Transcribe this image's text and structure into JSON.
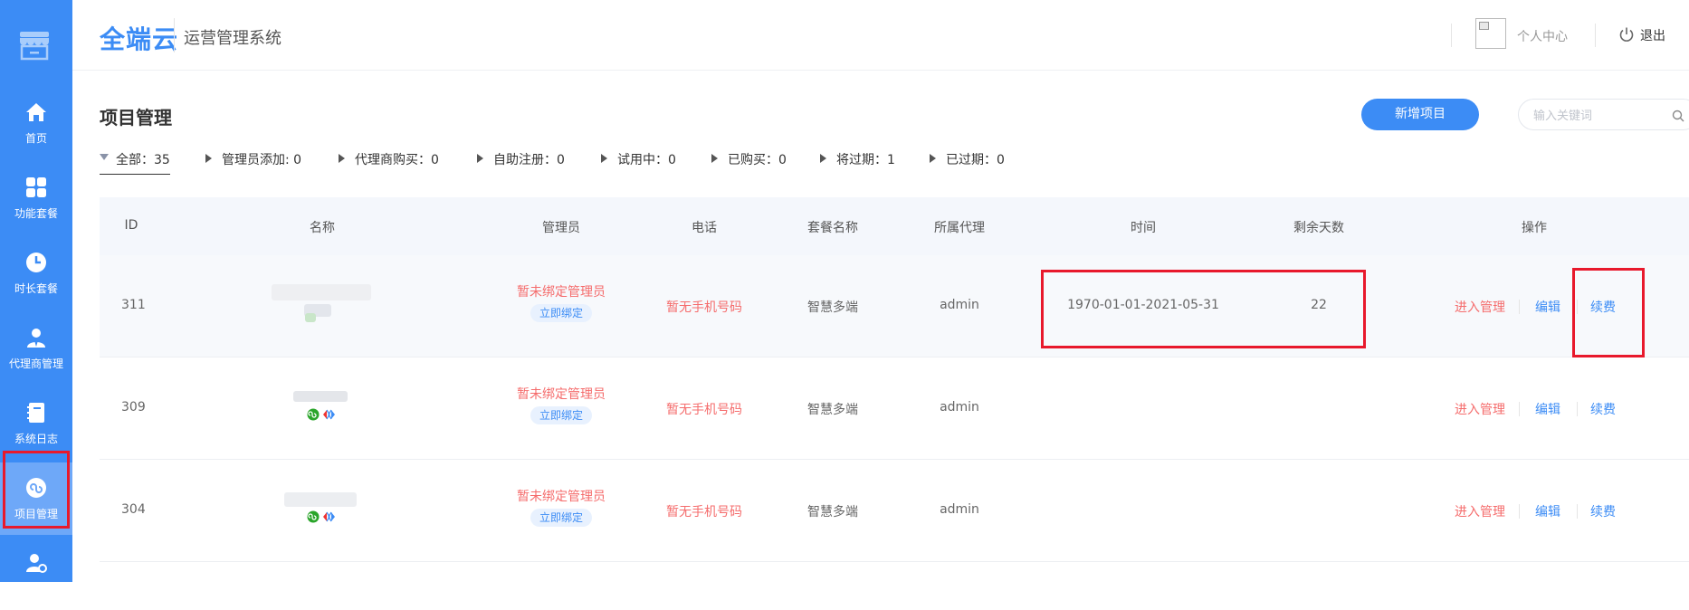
{
  "sidebar": {
    "items": [
      {
        "label": "首页",
        "icon": "home-icon"
      },
      {
        "label": "功能套餐",
        "icon": "grid-icon"
      },
      {
        "label": "时长套餐",
        "icon": "clock-icon"
      },
      {
        "label": "代理商管理",
        "icon": "agent-icon"
      },
      {
        "label": "系统日志",
        "icon": "log-book-icon"
      },
      {
        "label": "项目管理",
        "icon": "mini-program-icon"
      },
      {
        "label": "用户管理",
        "icon": "user-settings-icon"
      }
    ],
    "active_item": "项目管理"
  },
  "header": {
    "brand": "全端云",
    "system_name": "运营管理系统",
    "personal_center": "个人中心",
    "logout": "退出"
  },
  "page": {
    "title": "项目管理",
    "add_button": "新增项目",
    "search_placeholder": "输入关键词"
  },
  "filters": [
    {
      "label": "全部：35",
      "active": true
    },
    {
      "label": "管理员添加: 0"
    },
    {
      "label": "代理商购买：0"
    },
    {
      "label": "自助注册：0"
    },
    {
      "label": "试用中：0"
    },
    {
      "label": "已购买：0"
    },
    {
      "label": "将过期：1"
    },
    {
      "label": "已过期：0"
    }
  ],
  "table": {
    "columns": [
      "ID",
      "名称",
      "管理员",
      "电话",
      "套餐名称",
      "所属代理",
      "时间",
      "剩余天数",
      "操作"
    ],
    "rows": [
      {
        "id": "311",
        "admin": "暂未绑定管理员",
        "bind": "立即绑定",
        "phone": "暂无手机号码",
        "package": "智慧多端",
        "agent": "admin",
        "time": "1970-01-01-2021-05-31",
        "days": "22",
        "actions": [
          "进入管理",
          "编辑",
          "续费"
        ]
      },
      {
        "id": "309",
        "admin": "暂未绑定管理员",
        "bind": "立即绑定",
        "phone": "暂无手机号码",
        "package": "智慧多端",
        "agent": "admin",
        "time": "",
        "days": "",
        "actions": [
          "进入管理",
          "编辑",
          "续费"
        ]
      },
      {
        "id": "304",
        "admin": "暂未绑定管理员",
        "bind": "立即绑定",
        "phone": "暂无手机号码",
        "package": "智慧多端",
        "agent": "admin",
        "time": "",
        "days": "",
        "actions": [
          "进入管理",
          "编辑",
          "续费"
        ]
      }
    ]
  },
  "colors": {
    "primary": "#3c8cf5",
    "danger": "#f56c6c",
    "highlight": "#e8192c"
  }
}
